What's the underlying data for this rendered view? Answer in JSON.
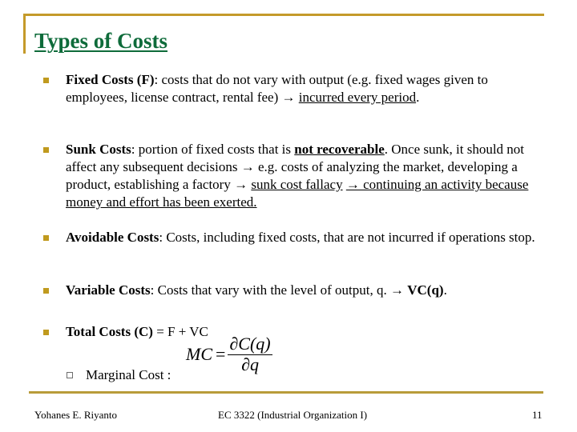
{
  "slide": {
    "title": "Types of Costs",
    "accent_color": "#c49a2a",
    "title_color": "#0e6b3a"
  },
  "bullets": [
    {
      "term": "Fixed Costs (F)",
      "text_1": ": costs that do not vary with output (e.g. fixed wages given to employees, license contract, rental fee) ",
      "arrow": "→",
      "underlined": "incurred every period",
      "text_2": "."
    },
    {
      "term": "Sunk Costs",
      "text_1": ": portion of fixed costs that is ",
      "underlined_bold": "not recoverable",
      "text_2": ". Once sunk, it should not affect any subsequent decisions ",
      "arrow_1": "→",
      "text_3": " e.g. costs of analyzing the market, developing a product, establishing a factory ",
      "arrow_2": "→",
      "underlined_1": "sunk cost fallacy",
      "underlined_2": "→ continuing an activity because money and effort has been exerted."
    },
    {
      "term": "Avoidable Costs",
      "text_1": ": Costs, including fixed costs, that are not incurred if operations stop."
    },
    {
      "term": "Variable Costs",
      "text_1": ": Costs that vary with the level of output, q. ",
      "arrow": "→",
      "bold_tail": "VC(q)",
      "text_2": "."
    },
    {
      "term": "Total Costs (C)",
      "text_1": " = F + VC"
    }
  ],
  "sub_bullet": {
    "label": "Marginal Cost :"
  },
  "formula": {
    "lhs": "MC",
    "eq": "=",
    "numerator": "∂C(q)",
    "denominator": "∂q"
  },
  "footer": {
    "author": "Yohanes E. Riyanto",
    "course": "EC 3322 (Industrial Organization I)",
    "page_number": "11"
  }
}
